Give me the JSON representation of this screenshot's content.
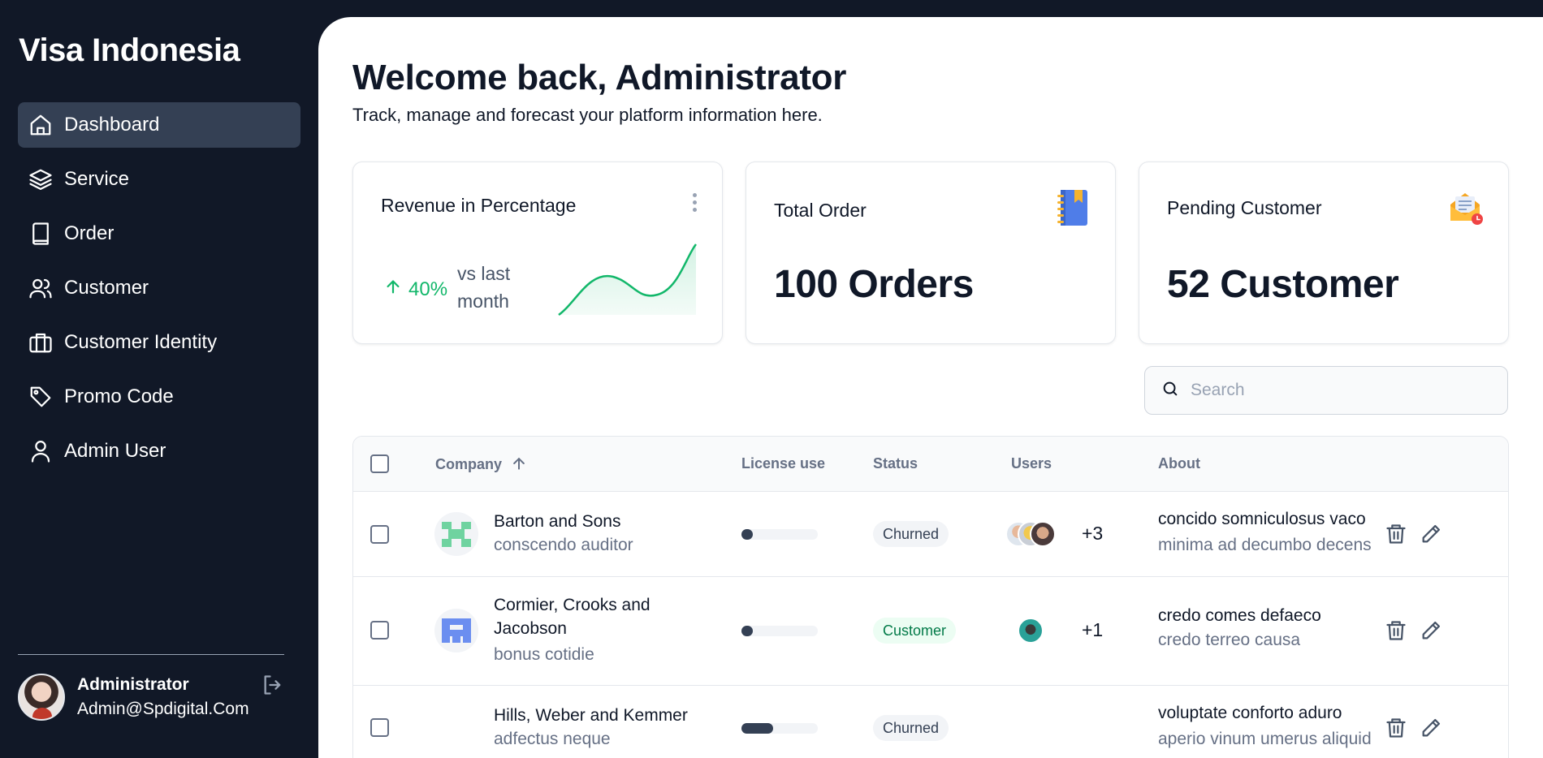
{
  "sidebar": {
    "brand": "Visa Indonesia",
    "items": [
      {
        "label": "Dashboard",
        "icon": "home-icon",
        "active": true
      },
      {
        "label": "Service",
        "icon": "layers-icon"
      },
      {
        "label": "Order",
        "icon": "book-icon"
      },
      {
        "label": "Customer",
        "icon": "users-icon"
      },
      {
        "label": "Customer Identity",
        "icon": "briefcase-icon"
      },
      {
        "label": "Promo Code",
        "icon": "tag-icon"
      },
      {
        "label": "Admin User",
        "icon": "user-icon"
      }
    ],
    "profile": {
      "name": "Administrator",
      "email": "Admin@Spdigital.Com"
    }
  },
  "header": {
    "title": "Welcome back, Administrator",
    "subtitle": "Track, manage and forecast your platform information here."
  },
  "cards": {
    "revenue": {
      "title": "Revenue in Percentage",
      "change": "40%",
      "note": "vs last month",
      "trend_color": "#12b76a"
    },
    "orders": {
      "title": "Total Order",
      "value": "100 Orders"
    },
    "pending": {
      "title": "Pending Customer",
      "value": "52 Customer"
    }
  },
  "search": {
    "placeholder": "Search",
    "value": ""
  },
  "table": {
    "headers": {
      "company": "Company",
      "license": "License use",
      "status": "Status",
      "users": "Users",
      "about": "About"
    },
    "rows": [
      {
        "company": "Barton and Sons",
        "sub": "conscendo auditor",
        "license": 0.15,
        "status": "Churned",
        "extra_users": "+3",
        "about_title": "concido somniculosus vaco",
        "about_sub": "minima ad decumbo decens"
      },
      {
        "company": "Cormier, Crooks and Jacobson",
        "sub": "bonus cotidie",
        "license": 0.15,
        "status": "Customer",
        "extra_users": "+1",
        "about_title": "credo comes defaeco",
        "about_sub": "credo terreo causa"
      },
      {
        "company": "Hills, Weber and Kemmer",
        "sub": "adfectus neque",
        "license": 0.42,
        "status": "Churned",
        "extra_users": "",
        "about_title": "voluptate conforto aduro",
        "about_sub": "aperio vinum umerus aliquid"
      }
    ]
  }
}
